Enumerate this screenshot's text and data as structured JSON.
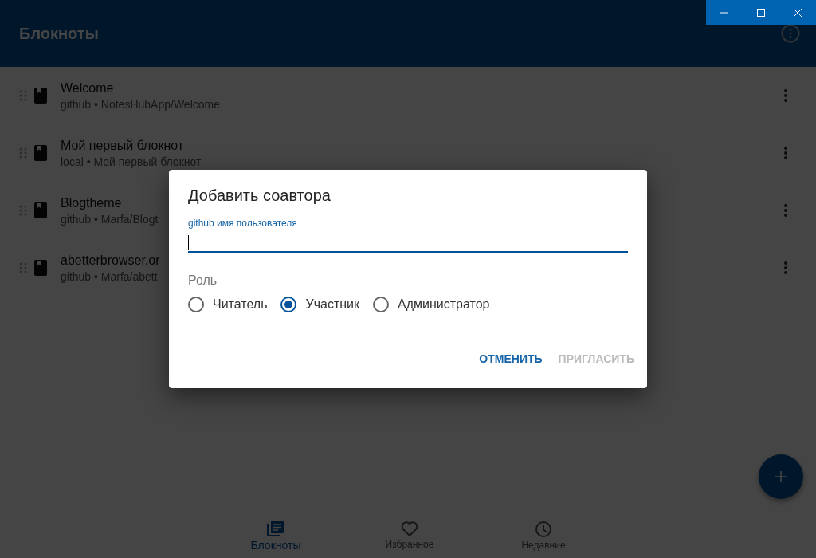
{
  "app_bar": {
    "title": "Блокноты"
  },
  "notebooks": [
    {
      "title": "Welcome",
      "subtitle": "github • NotesHubApp/Welcome"
    },
    {
      "title": "Мой первый блокнот",
      "subtitle": "local • Мой первый блокнот"
    },
    {
      "title": "Blogtheme",
      "subtitle": "github • Marfa/Blogt"
    },
    {
      "title": "abetterbrowser.or",
      "subtitle": "github • Marfa/abett"
    }
  ],
  "bottom_nav": [
    {
      "kind": "notebooks",
      "label": "Блокноты",
      "selected": true
    },
    {
      "kind": "favorites",
      "label": "Избранное",
      "selected": false
    },
    {
      "kind": "recent",
      "label": "Недавние",
      "selected": false
    }
  ],
  "dialog": {
    "title": "Добавить соавтора",
    "field_label": "github имя пользователя",
    "role_label": "Роль",
    "roles": [
      {
        "label": "Читатель",
        "selected": false
      },
      {
        "label": "Участник",
        "selected": true
      },
      {
        "label": "Администратор",
        "selected": false
      }
    ],
    "buttons": [
      {
        "label": "ОТМЕНИТЬ",
        "disabled": false
      },
      {
        "label": "ПРИГЛАСИТЬ",
        "disabled": true
      }
    ]
  }
}
